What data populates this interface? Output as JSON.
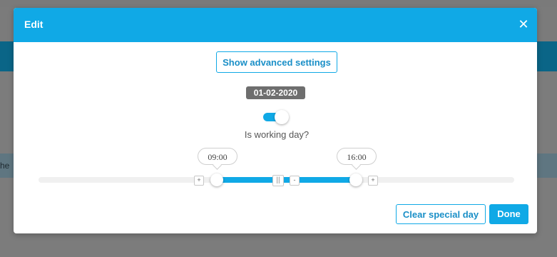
{
  "background": {
    "row_text": "he"
  },
  "modal": {
    "title": "Edit",
    "close_glyph": "✕",
    "advanced_button": "Show advanced settings",
    "date": "01-02-2020",
    "working_day": {
      "label": "Is working day?",
      "checked": true
    },
    "time_range": {
      "start": "09:00",
      "end": "16:00",
      "minus_glyph": "-",
      "plus_glyph": "+",
      "pause_glyph": "||"
    },
    "clear_button": "Clear special day",
    "done_button": "Done"
  },
  "colors": {
    "accent": "#10a9e6",
    "badge": "#6e6e6e"
  }
}
